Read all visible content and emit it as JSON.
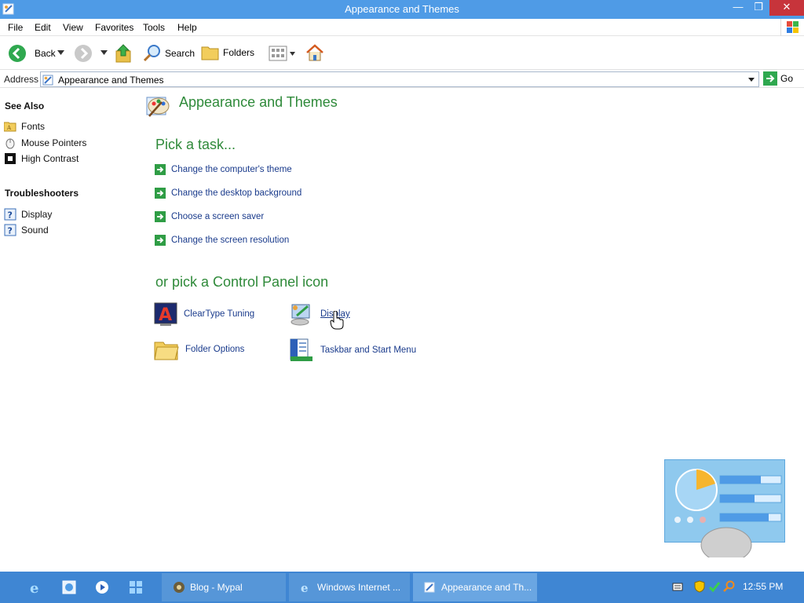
{
  "window": {
    "title": "Appearance and Themes"
  },
  "menu": [
    "File",
    "Edit",
    "View",
    "Favorites",
    "Tools",
    "Help"
  ],
  "toolbar": {
    "back": "Back",
    "search": "Search",
    "folders": "Folders"
  },
  "address": {
    "label": "Address",
    "value": "Appearance and Themes",
    "go": "Go"
  },
  "see_also": {
    "heading": "See Also",
    "items": [
      "Fonts",
      "Mouse Pointers",
      "High Contrast"
    ]
  },
  "troubleshooters": {
    "heading": "Troubleshooters",
    "items": [
      "Display",
      "Sound"
    ]
  },
  "main": {
    "title": "Appearance and Themes",
    "pick_task": "Pick a task...",
    "tasks": [
      "Change the computer's theme",
      "Change the desktop background",
      "Choose a screen saver",
      "Change the screen resolution"
    ],
    "pick_icon": "or pick a Control Panel icon",
    "icons": [
      "ClearType Tuning",
      "Display",
      "Folder Options",
      "Taskbar and Start Menu"
    ]
  },
  "taskbar": {
    "tasks": [
      "Blog - Mypal",
      "Windows Internet ...",
      "Appearance and Th..."
    ],
    "clock": "12:55 PM"
  },
  "colors": {
    "title_bar": "#4f9be6",
    "close_button": "#c7343b",
    "heading_green": "#2f8a3a",
    "link_blue": "#1a3b8c",
    "taskbar": "#3f86d3"
  }
}
